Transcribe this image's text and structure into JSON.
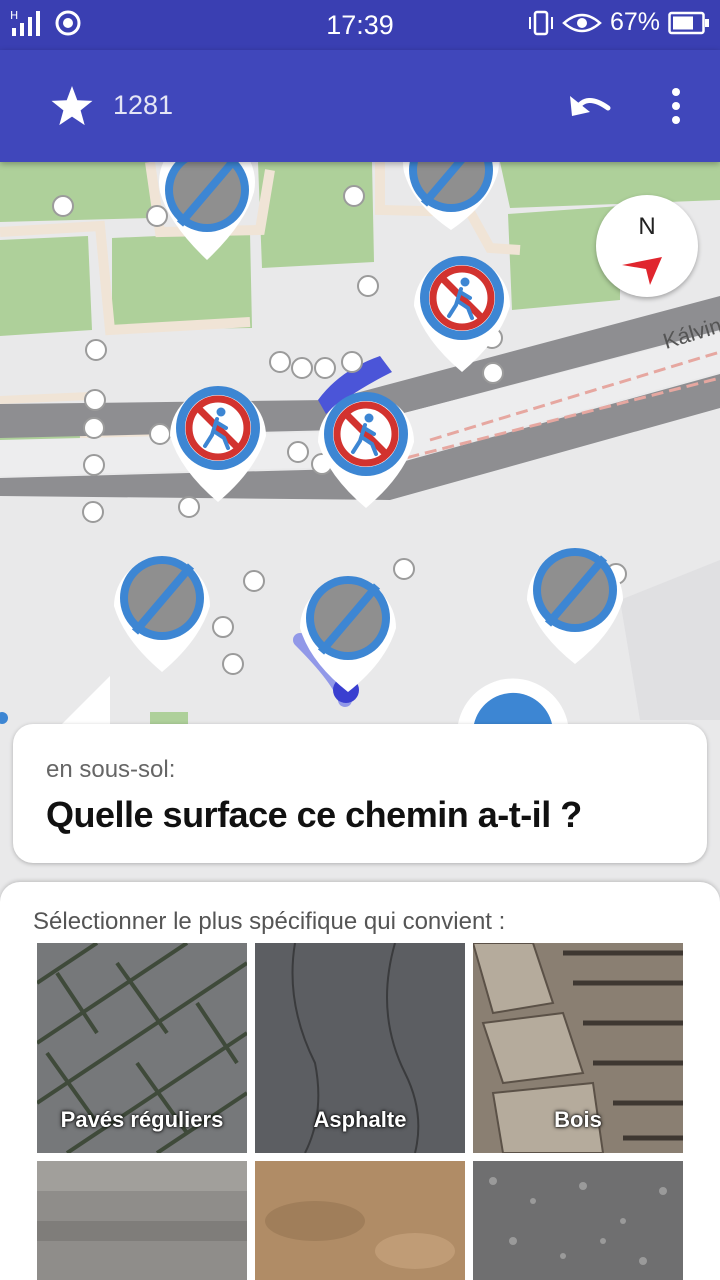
{
  "status_bar": {
    "time": "17:39",
    "battery": "67%",
    "network": "H"
  },
  "toolbar": {
    "score": "1281"
  },
  "map": {
    "street_label": "Kálvin",
    "compass_label": "N"
  },
  "quest": {
    "subtitle": "en sous-sol:",
    "question": "Quelle surface ce chemin a-t-il ?"
  },
  "answers": {
    "hint": "Sélectionner le plus spécifique qui convient :",
    "options": [
      {
        "label": "Pavés réguliers"
      },
      {
        "label": "Asphalte"
      },
      {
        "label": "Bois"
      },
      {
        "label": ""
      },
      {
        "label": ""
      },
      {
        "label": ""
      }
    ]
  },
  "colors": {
    "appbar": "#4047bb",
    "statusbar": "#3a3fb2",
    "compass_arrow": "#e0262e",
    "pin_blue": "#3d86d3",
    "pin_red": "#d2332f"
  }
}
